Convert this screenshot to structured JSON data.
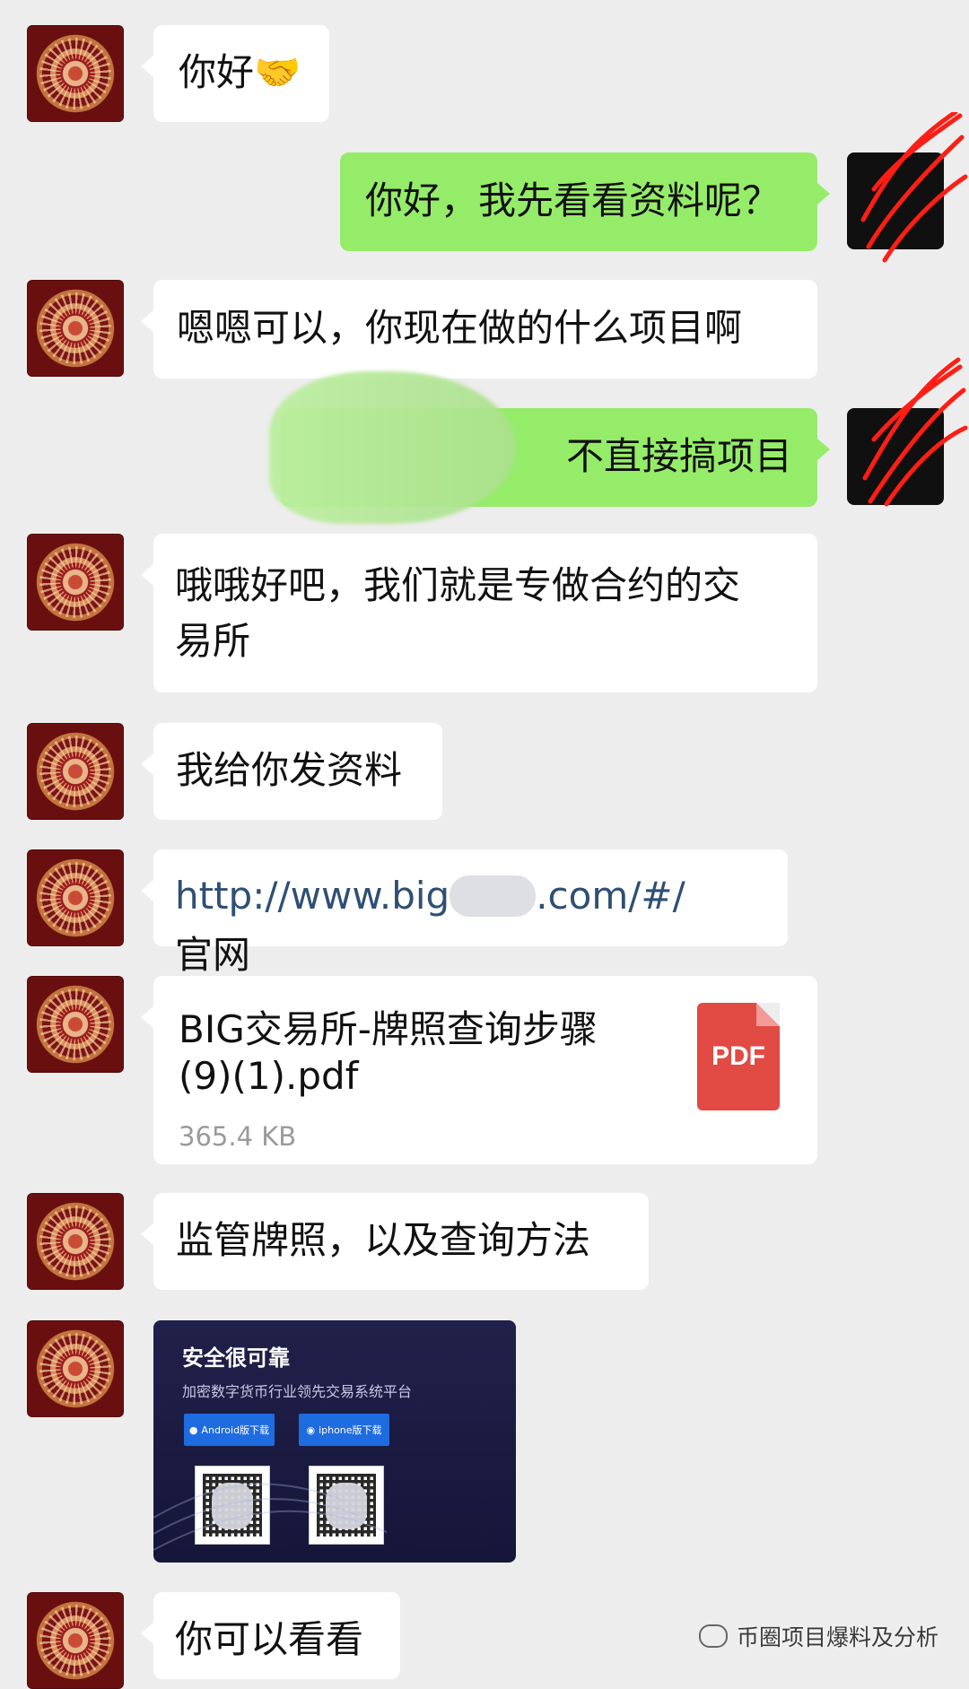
{
  "messages": [
    {
      "text": "你好🤝"
    },
    {
      "text": "你好，我先看看资料呢？"
    },
    {
      "text": "嗯嗯可以，你现在做的什么项目啊"
    },
    {
      "text": "不直接搞项目"
    },
    {
      "line1": "哦哦好吧，我们就是专做合约的交",
      "line2": "易所"
    },
    {
      "text": "我给你发资料"
    },
    {
      "prefix": "http://www.big",
      "suffix": ".com/#/",
      "label": "官网"
    },
    {
      "title_line1": "BIG交易所-牌照查询步骤",
      "title_line2": "(9)(1).pdf",
      "size": "365.4 KB",
      "badge": "PDF"
    },
    {
      "text": "监管牌照，以及查询方法"
    },
    {
      "card_title": "安全很可靠",
      "card_subtitle": "加密数字货币行业领先交易系统平台",
      "android_button": "Android版下载",
      "iphone_button": "iphone版下载"
    },
    {
      "text": "你可以看看"
    }
  ],
  "watermark": "币圈项目爆料及分析",
  "icons": {
    "avatar": "portrait-icon",
    "pdf": "pdf-icon",
    "wechat": "wechat-icon"
  }
}
